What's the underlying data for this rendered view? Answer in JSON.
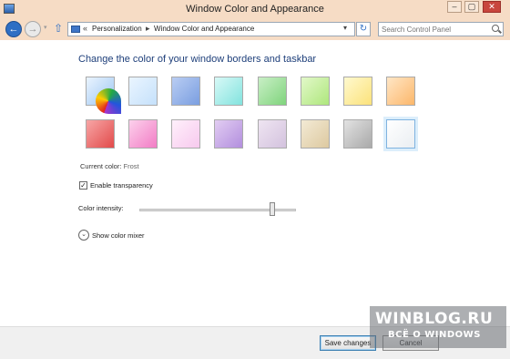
{
  "window": {
    "title": "Window Color and Appearance",
    "controls": {
      "minimize": "–",
      "maximize": "▢",
      "close": "✕"
    }
  },
  "nav": {
    "back_glyph": "←",
    "forward_glyph": "→",
    "history_glyph": "▾",
    "up_glyph": "⇧",
    "breadcrumb_lead": "«",
    "breadcrumb": [
      "Personalization",
      "Window Color and Appearance"
    ],
    "breadcrumb_sep": "▸",
    "dropdown_glyph": "▾",
    "refresh_glyph": "↻",
    "search_placeholder": "Search Control Panel"
  },
  "main": {
    "heading": "Change the color of your window borders and taskbar",
    "swatches": [
      {
        "id": "automatic",
        "colors": [
          "#ffffff",
          "#e02020",
          "#ffcc00",
          "#22aa44",
          "#2255dd",
          "#aa33cc"
        ]
      },
      {
        "id": "sky",
        "colors": [
          "#eaf5ff",
          "#c5e1fb"
        ]
      },
      {
        "id": "twilight",
        "colors": [
          "#b9cdf3",
          "#7a9ee0"
        ]
      },
      {
        "id": "sea-foam",
        "colors": [
          "#d8f9f7",
          "#82e3de"
        ]
      },
      {
        "id": "leaf",
        "colors": [
          "#c9efc6",
          "#7fd47c"
        ]
      },
      {
        "id": "lime",
        "colors": [
          "#e2f8c9",
          "#aee77c"
        ]
      },
      {
        "id": "sun",
        "colors": [
          "#fff9cf",
          "#fbe27a"
        ]
      },
      {
        "id": "pumpkin",
        "colors": [
          "#ffe6c6",
          "#fcb76a"
        ]
      },
      {
        "id": "ruby",
        "colors": [
          "#f7a6a6",
          "#e24a4a"
        ]
      },
      {
        "id": "fuchsia",
        "colors": [
          "#fcd1ec",
          "#f27cc5"
        ]
      },
      {
        "id": "blush",
        "colors": [
          "#fff0fb",
          "#f7c9ee"
        ]
      },
      {
        "id": "violet",
        "colors": [
          "#e2cdf2",
          "#b28ede"
        ]
      },
      {
        "id": "lavender",
        "colors": [
          "#efe5f2",
          "#d3c2de"
        ]
      },
      {
        "id": "taupe",
        "colors": [
          "#f3ead5",
          "#ddc9a0"
        ]
      },
      {
        "id": "chocolate",
        "colors": [
          "#e2e2e2",
          "#a9a9a9"
        ]
      },
      {
        "id": "frost",
        "colors": [
          "#ffffff",
          "#eaeef2"
        ]
      }
    ],
    "selected_swatch_index": 15,
    "current_color_label": "Current color:",
    "current_color_value": "Frost",
    "transparency_label": "Enable transparency",
    "transparency_checked": true,
    "intensity_label": "Color intensity:",
    "intensity_value": 0.85,
    "mixer_label": "Show color mixer",
    "mixer_glyph": "⌄"
  },
  "footer": {
    "save_label": "Save changes",
    "cancel_label": "Cancel"
  },
  "watermark": {
    "title": "WINBLOG.RU",
    "subtitle": "ВСЁ О WINDOWS"
  },
  "theme": {
    "frame": "#f6dcc5",
    "heading": "#1e3f7a",
    "accent": "#2f6fc4"
  }
}
